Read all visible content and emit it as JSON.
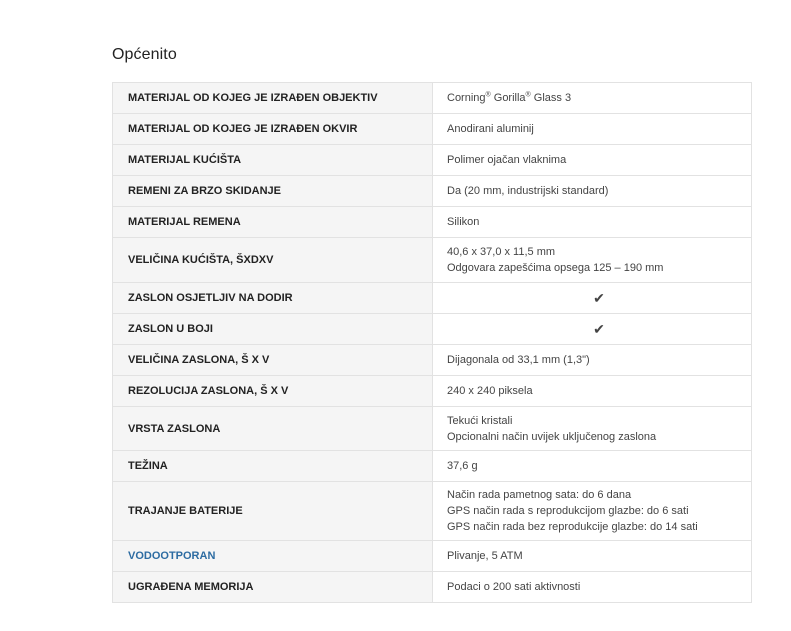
{
  "section": {
    "title": "Općenito"
  },
  "rows": [
    {
      "key": "MATERIJAL OD KOJEG JE IZRAĐEN OBJEKTIV",
      "value_parts": [
        "Corning",
        "®",
        " Gorilla",
        "®",
        " Glass 3"
      ]
    },
    {
      "key": "MATERIJAL OD KOJEG JE IZRAĐEN OKVIR",
      "lines": [
        "Anodirani aluminij"
      ]
    },
    {
      "key": "MATERIJAL KUĆIŠTA",
      "lines": [
        "Polimer ojačan vlaknima"
      ]
    },
    {
      "key": "REMENI ZA BRZO SKIDANJE",
      "lines": [
        "Da (20 mm, industrijski standard)"
      ]
    },
    {
      "key": "MATERIJAL REMENA",
      "lines": [
        "Silikon"
      ]
    },
    {
      "key": "VELIČINA KUĆIŠTA, ŠXDXV",
      "lines": [
        "40,6 x 37,0 x 11,5 mm",
        "Odgovara zapešćima opsega 125 – 190 mm"
      ]
    },
    {
      "key": "ZASLON OSJETLJIV NA DODIR",
      "check": "✔"
    },
    {
      "key": "ZASLON U BOJI",
      "check": "✔"
    },
    {
      "key": "VELIČINA ZASLONA, Š X V",
      "lines": [
        "Dijagonala od 33,1 mm (1,3\")"
      ]
    },
    {
      "key": "REZOLUCIJA ZASLONA, Š X V",
      "lines": [
        "240 x 240 piksela"
      ]
    },
    {
      "key": "VRSTA ZASLONA",
      "lines": [
        "Tekući kristali",
        "Opcionalni način uvijek uključenog zaslona"
      ]
    },
    {
      "key": "TEŽINA",
      "lines": [
        "37,6 g"
      ]
    },
    {
      "key": "TRAJANJE BATERIJE",
      "lines": [
        "Način rada pametnog sata: do 6 dana",
        "GPS način rada s reprodukcijom glazbe: do 6 sati",
        "GPS način rada bez reprodukcije glazbe: do 14 sati"
      ]
    },
    {
      "key": "VODOOTPORAN",
      "lines": [
        "Plivanje, 5 ATM"
      ]
    },
    {
      "key": "UGRAĐENA MEMORIJA",
      "lines": [
        "Podaci o 200 sati aktivnosti"
      ]
    }
  ],
  "colors": {
    "link": "#2d6ca2",
    "key_bg": "#f5f5f5",
    "border": "#e2e2e2"
  }
}
